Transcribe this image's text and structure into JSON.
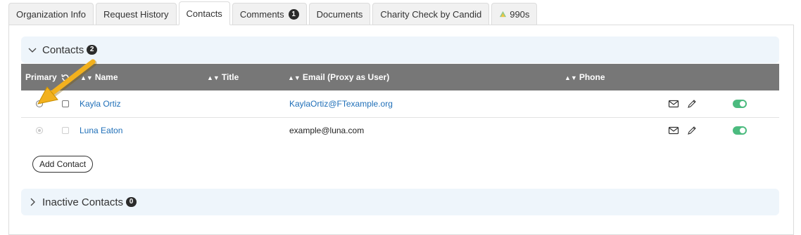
{
  "tabs": [
    {
      "label": "Organization Info"
    },
    {
      "label": "Request History"
    },
    {
      "label": "Contacts",
      "active": true
    },
    {
      "label": "Comments",
      "count": "1"
    },
    {
      "label": "Documents"
    },
    {
      "label": "Charity Check by Candid"
    },
    {
      "label": "990s",
      "icon": "candid-990-icon"
    }
  ],
  "contacts": {
    "title": "Contacts",
    "count": "2",
    "columns": {
      "primary": "Primary",
      "name": "Name",
      "title": "Title",
      "email": "Email (Proxy as User)",
      "phone": "Phone"
    },
    "rows": [
      {
        "name": "Kayla Ortiz",
        "email": "KaylaOrtiz@FTexample.org",
        "email_link": true,
        "active": true
      },
      {
        "name": "Luna Eaton",
        "email": "example@luna.com",
        "email_link": false,
        "active": true
      }
    ],
    "add_button": "Add Contact"
  },
  "inactive": {
    "title": "Inactive Contacts",
    "count": "0"
  },
  "colors": {
    "header_bg": "#777777",
    "link": "#1f6fb8",
    "toggle_on": "#4cbb7f",
    "section_bg": "#eef5fb",
    "arrow": "#f2b11e"
  }
}
